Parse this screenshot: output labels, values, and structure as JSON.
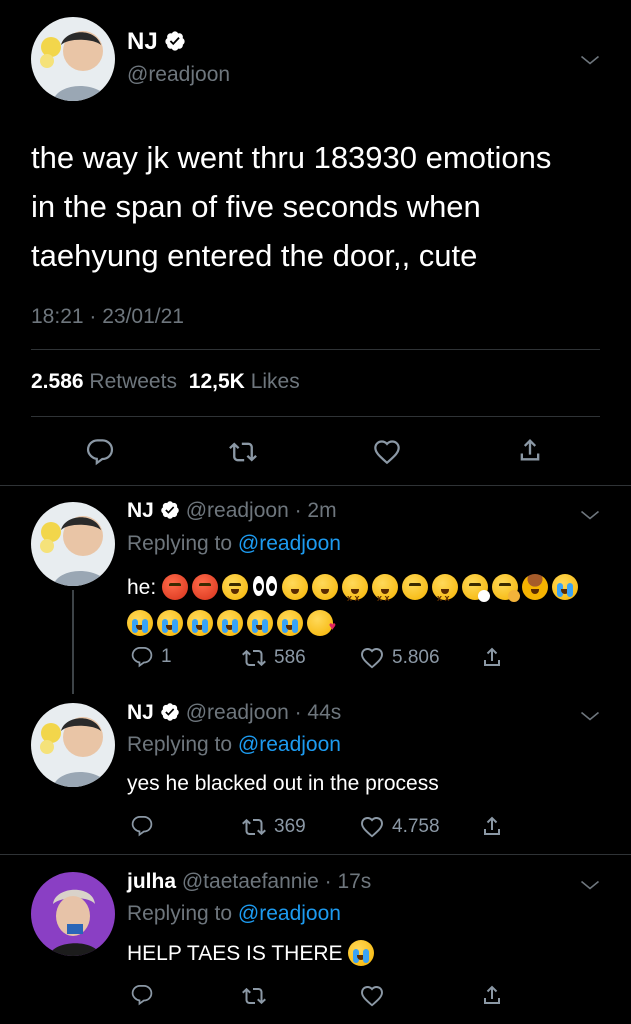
{
  "main_tweet": {
    "display_name": "NJ",
    "handle": "@readjoon",
    "text_lines": [
      "the way jk went thru 183930 emotions",
      "in the span of five seconds when",
      "taehyung entered the door,, cute"
    ],
    "timestamp": "18:21 · 23/01/21",
    "retweets_count": "2.586",
    "retweets_label": "Retweets",
    "likes_count": "12,5K",
    "likes_label": "Likes"
  },
  "replies": [
    {
      "display_name": "NJ",
      "handle": "@readjoon",
      "time": "· 2m",
      "replying_prefix": "Replying to",
      "replying_to": "@readjoon",
      "text": "he:",
      "reply_count": "1",
      "retweet_count": "586",
      "like_count": "5.806"
    },
    {
      "display_name": "NJ",
      "handle": "@readjoon",
      "time": "· 44s",
      "replying_prefix": "Replying to",
      "replying_to": "@readjoon",
      "text": "yes he blacked out in the process",
      "reply_count": "",
      "retweet_count": "369",
      "like_count": "4.758"
    },
    {
      "display_name": "julha",
      "handle": "@taetaefannie",
      "time": "· 17s",
      "replying_prefix": "Replying to",
      "replying_to": "@readjoon",
      "text": "HELP TAES IS THERE",
      "reply_count": "",
      "retweet_count": "",
      "like_count": ""
    }
  ],
  "colors": {
    "background": "#000000",
    "text": "#ffffff",
    "muted": "#6e767d",
    "link": "#1d9bf0",
    "divider": "#2f3336"
  },
  "icons": [
    "verified-icon",
    "chevron-down-icon",
    "reply-icon",
    "retweet-icon",
    "like-icon",
    "share-icon"
  ]
}
